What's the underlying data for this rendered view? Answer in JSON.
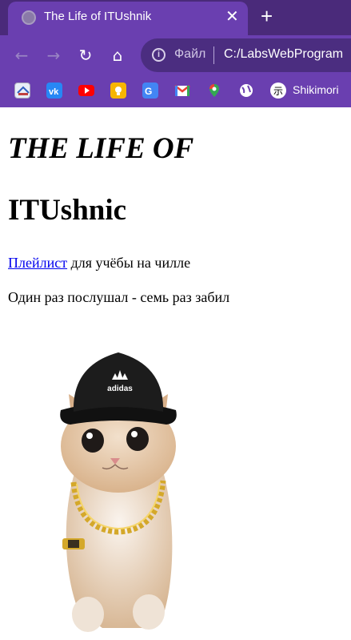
{
  "browser": {
    "tab": {
      "title": "The Life of ITUshnik",
      "close": "✕"
    },
    "new_tab": "+",
    "toolbar": {
      "scheme_label": "Файл",
      "url": "C:/LabsWebProgram"
    },
    "bookmarks": {
      "last_label": "Shikimori"
    },
    "accent_color": "#6a3fb0",
    "tabstrip_color": "#4a2a7a"
  },
  "page": {
    "heading1": "THE LIFE OF",
    "heading2": "ITUshnic",
    "paragraph1": {
      "link_text": "Плейлист",
      "rest_text": " для учёбы на чилле"
    },
    "paragraph2": "Один раз послушал - семь раз забил",
    "image": {
      "logo_text": "adidas"
    }
  }
}
